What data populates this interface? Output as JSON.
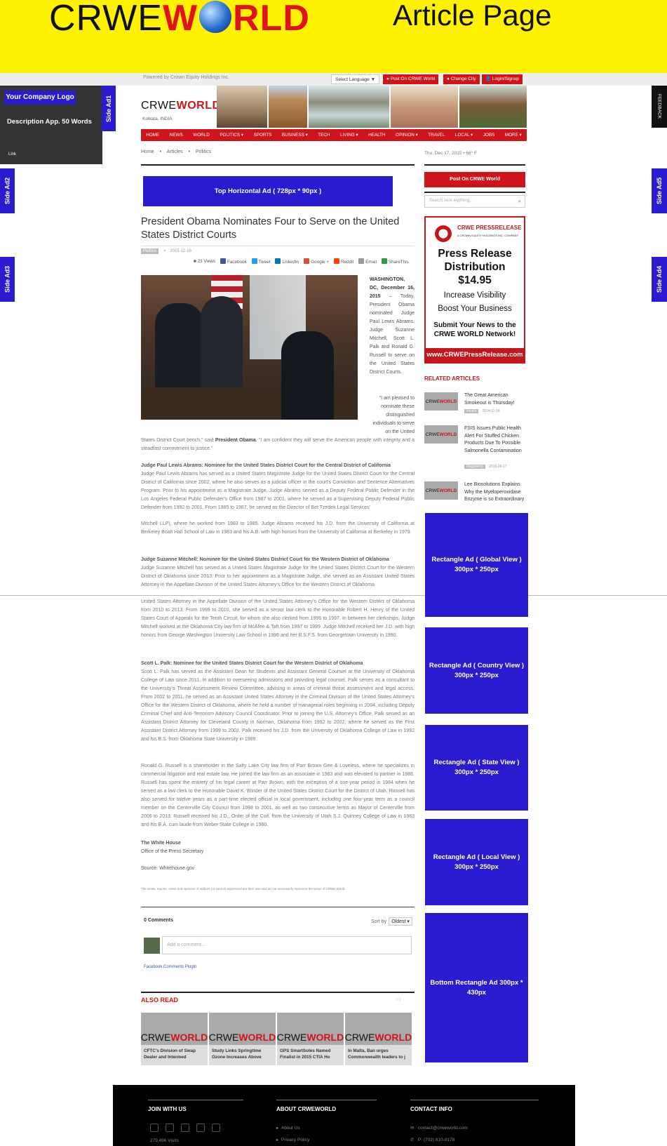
{
  "banner": {
    "brand_pre": "CRWE",
    "brand_red": "W",
    "brand_post": "RLD",
    "page_label": "Article Page"
  },
  "topbar": {
    "powered_by": "Powered by Crown Equity Holdings Inc.",
    "language": "Select Language ▼",
    "post_btn": "● Post On CRWE World",
    "city_btn": "● Change City",
    "login_btn": "👤 Login/Signup"
  },
  "company_box": {
    "logo": "Your Company Logo",
    "description": "Description App. 50 Words",
    "link": "Link"
  },
  "side_ads": {
    "ad1": "Side Ad1",
    "ad2": "Side Ad2",
    "ad3": "Side Ad3",
    "ad4": "Side Ad4",
    "ad5": "Side Ad5",
    "feedback": "FEEDBACK"
  },
  "site": {
    "logo_pre": "CRWE",
    "logo_red": "WORLD",
    "city": "Kolkata, INDIA"
  },
  "nav": [
    "HOME",
    "NEWS",
    "WORLD",
    "POLITICS ▾",
    "SPORTS",
    "BUSINESS ▾",
    "TECH",
    "LIVING ▾",
    "HEALTH",
    "OPINION ▾",
    "TRAVEL",
    "LOCAL ▾",
    "JOBS",
    "MORE ▾"
  ],
  "breadcrumb": [
    "Home",
    "•",
    "Articles",
    "•",
    "Politics"
  ],
  "top_ad": "Top Horizontal Ad ( 728px * 90px )",
  "article": {
    "title": "President Obama Nominates Four to Serve on the United States District Courts",
    "category": "Politics",
    "date": "2015-12-16",
    "views": "23 Views",
    "share": [
      "Facebook",
      "Tweet",
      "LinkedIn",
      "Google +",
      "Reddit",
      "Email",
      "ShareThis"
    ],
    "intro_bold": "WASHINGTON, DC, December 16, 2015",
    "intro": " – Today, President Obama nominated Judge Paul Lewis Abrams, Judge Suzanne Mitchell, Scott L. Palk and Ronald G. Russell to serve on the United States District Courts.",
    "quote": "“I am pleased to nominate these distinguished individuals to serve on the United",
    "quote_cont_a": "States District Court bench,” said ",
    "quote_cont_bold": "President Obama",
    "quote_cont_b": ". “I am confident they will serve the American people with integrity and a steadfast commitment to justice.”",
    "p1_head": "Judge Paul Lewis Abrams:  Nominee for the United States District Court for the Central District of California",
    "p1": "Judge Paul Lewis Abrams has served as a United States Magistrate Judge for the United States District Court for the Central District of California since 2002, where he also serves as a judicial officer in the court’s Conviction and Sentence Alternatives Program.  Prior to his appointment as a Magistrate Judge, Judge Abrams served as a Deputy Federal Public Defender in the Los Angeles Federal Public Defender’s Office from 1987 to 2001, where he served as a Supervising Deputy Federal Public Defender from 1992 to 2001.  From 1985 to 1987, he served as the Director of Bet Tzedek Legal Services’",
    "p1b": "Mitchell LLP), where he worked from 1983 to 1985.  Judge Abrams received his J.D. from the University of California at Berkeley Boalt Hall School of Law in 1983 and his A.B. with high honors from the University of California at Berkeley in 1979.",
    "p2_head": "Judge Suzanne Mitchell:  Nominee for the United States District Court for the Western District of Oklahoma",
    "p2": "Judge Suzanne Mitchell has served as a United States Magistrate Judge for the United States District Court for the Western District of Oklahoma since 2013.  Prior to her appointment as a Magistrate Judge, she served as an Assistant United States Attorney in the Appellate Division of the United States Attorney’s Office for the Western District of Oklahoma",
    "p2b": "United States Attorney in the Appellate Division of the United States Attorney’s Office for the Western District of Oklahoma from 2010 to 2013.  From 1999 to 2010, she served as a senior law clerk to the Honorable Robert H. Henry of the United States Court of Appeals for the Tenth Circuit, for whom she also clerked from 1996 to 1997.  In between her clerkships, Judge Mitchell worked at the Oklahoma City law firm of McAfee & Taft from 1997 to 1999.  Judge Mitchell received her J.D. with high honors from George Washington University Law School in 1996 and her B.S.F.S. from Georgetown University in 1990.",
    "p3_head": "Scott L. Palk:  Nominee for the United States District Court for the Western District of Oklahoma",
    "p3": "Scott L. Palk has served as the Assistant Dean for Students and Assistant General Counsel at the University of Oklahoma College of Law since 2011.  In addition to overseeing admissions and providing legal counsel, Palk serves as a consultant to the University’s Threat Assessment Review Committee, advising in areas of criminal threat assessment and legal access. From 2002 to 2011, he served as an Assistant United States Attorney in the Criminal Division of the United States Attorney’s Office for the Western District of Oklahoma, where he held a number of managerial roles beginning in 2004, including Deputy Criminal Chief and Anti-Terrorism Advisory Council Coordinator.  Prior to joining the U.S. Attorney’s Office, Palk served as an Assistant District Attorney for Cleveland County in Norman, Oklahoma from 1992 to 2002, where he served as the First Assistant District Attorney from 1999 to 2002.  Palk received his J.D. from the University of Oklahoma College of Law in 1992 and his B.S. from Oklahoma State University in 1989.",
    "p4": "Ronald G. Russell is a shareholder in the Salty Lake City law firm of Parr Brown Gee & Loveless, where he specializes in commercial litigation and real estate law.  He joined the law firm as an associate in 1983 and was elevated to partner in 1988.  Russell has spent the entirety of his legal career at Parr Brown, with the exception of a one-year period in 1984 when he served as a law clerk to the Honorable David K. Winder of the United States District Court for the District of Utah.  Russell has also served for twelve years as a part-time elected official in local government, including one four-year term as a council member on the Centerville City Council from 1998 to 2001, as well as two consecutive terms as Mayor of Centerville from 2006 to 2013.  Russell received his J.D., Order of the Coif, from the University of Utah S.J. Quinney College of Law in 1983 and his B.A. cum laude from Weber State College in 1980.",
    "sign1": "The White House",
    "sign2": "Office of the Press Secretary",
    "source": "Source: Whitehouse.gov",
    "disclaimer": "The views, reports, views and opinions of authors (or source) expressed are their own and do not necessarily represent the views of CRWE World."
  },
  "comments": {
    "count": "0 Comments",
    "sort_label": "Sort by",
    "sort_value": "Oldest ▾",
    "placeholder": "Add a comment...",
    "plugin": "Facebook Comments Plugin"
  },
  "also_read": {
    "heading": "ALSO READ",
    "nav": "‹ ›",
    "items": [
      {
        "caption": "CFTC's Division of Swap Dealer and Intermed"
      },
      {
        "caption": "Study Links Springtime Ozone Increases Above"
      },
      {
        "caption": "GPS SmartSoles Named Finalist in 2015 CTIA Ho"
      },
      {
        "caption": "In Malta, Ban urges Commonwealth leaders to j"
      }
    ]
  },
  "sidebar": {
    "dateline": "Thu, Dec 17, 2015  •  66° F",
    "post_btn": "Post On CRWE World",
    "search_placeholder": "Search here anything...",
    "press": {
      "brand": "CRWE PRESSRELEASE",
      "sub": "A CROWN EQUITY HOLDINGS INC. COMPANY",
      "h1a": "Press Release",
      "h1b": "Distribution",
      "h1c": "$14.95",
      "h2a": "Increase Visibility",
      "h2b": "Boost Your Business",
      "h3a": "Submit Your News to the",
      "h3b": "CRWE WORLD Network!",
      "url": "www.CRWEPressRelease.com"
    },
    "related_heading": "RELATED ARTICLES",
    "related": [
      {
        "title": "The Great American Smokeout is Thursday!",
        "tag": "Health",
        "date": "2014-11-18"
      },
      {
        "title": "FSIS Issues Public Health Alert For Stuffed Chicken Products Due To Possible Salmonella Contamination",
        "tag": "Regulatory",
        "date": "2015-09-17"
      },
      {
        "title": "Lee Biosolutions Explains Why the Myeloperoxidase Enzyme is so Extraordinary",
        "tag": "",
        "date": ""
      }
    ],
    "ad_global": "Rectangle Ad ( Global View ) 300px * 250px",
    "ad_country": "Rectangle Ad ( Country View ) 300px * 250px",
    "ad_state": "Rectangle Ad ( State View ) 300px * 250px",
    "ad_local": "Rectangle Ad ( Local View ) 300px * 250px",
    "ad_bottom": "Bottom Rectangle Ad 300px * 430px"
  },
  "footer": {
    "join": "JOIN WITH US",
    "about": "ABOUT CRWEWORLD",
    "contact": "CONTACT INFO",
    "about_link1": "About Us",
    "about_link2": "Privacy Policy",
    "email": "contact@crweworld.com",
    "phone": "P: (702) 810-0178",
    "visits": "279,496 Visits"
  }
}
